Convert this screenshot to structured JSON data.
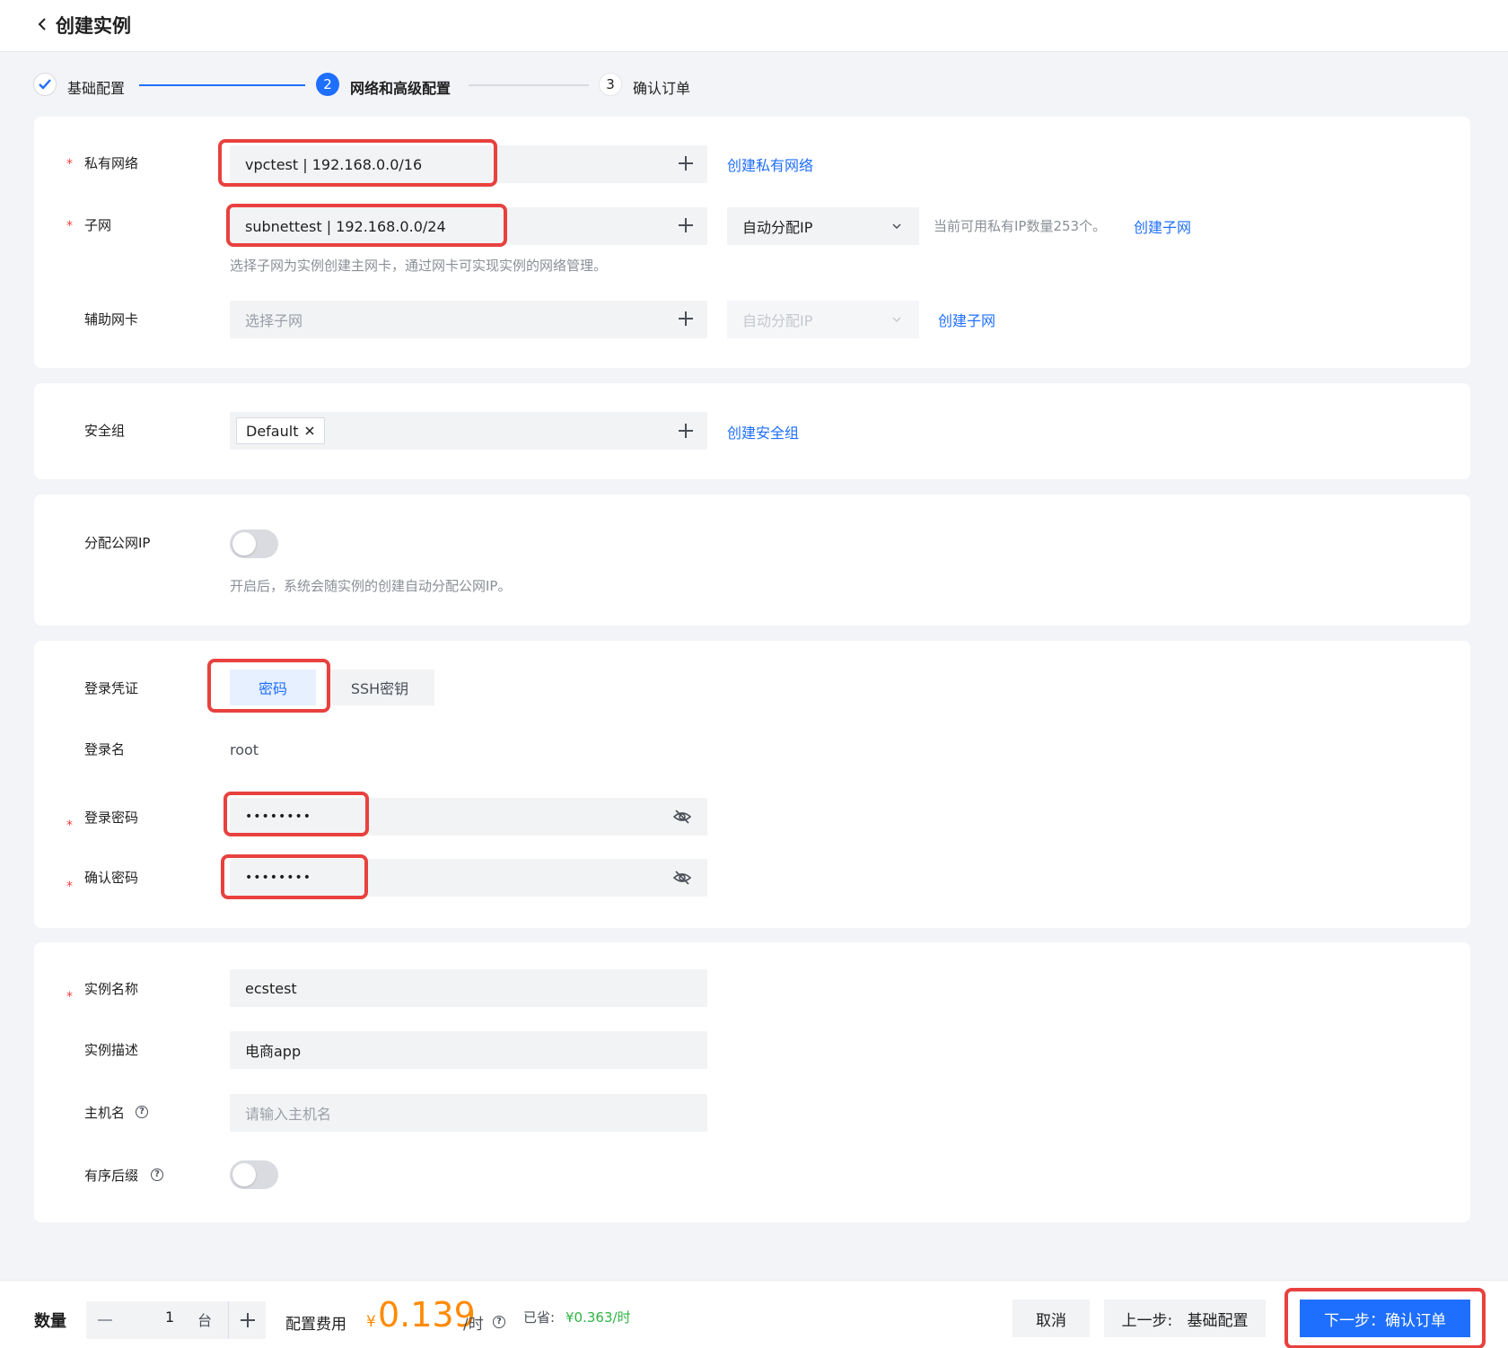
{
  "header": {
    "title": "创建实例"
  },
  "steps": [
    {
      "label": "基础配置",
      "state": "done"
    },
    {
      "number": "2",
      "label": "网络和高级配置",
      "state": "active"
    },
    {
      "number": "3",
      "label": "确认订单",
      "state": "pending"
    }
  ],
  "network": {
    "vpc": {
      "label": "私有网络",
      "value": "vpctest | 192.168.0.0/16",
      "link": "创建私有网络"
    },
    "subnet": {
      "label": "子网",
      "value": "subnettest | 192.168.0.0/24",
      "ip_mode": "自动分配IP",
      "available_hint": "当前可用私有IP数量253个。",
      "link": "创建子网",
      "hint": "选择子网为实例创建主网卡，通过网卡可实现实例的网络管理。"
    },
    "secondary_nic": {
      "label": "辅助网卡",
      "placeholder": "选择子网",
      "ip_mode": "自动分配IP",
      "link": "创建子网"
    }
  },
  "security": {
    "label": "安全组",
    "tag": "Default",
    "link": "创建安全组"
  },
  "public_ip": {
    "label": "分配公网IP",
    "hint": "开启后，系统会随实例的创建自动分配公网IP。",
    "enabled": false
  },
  "login": {
    "credential_label": "登录凭证",
    "credential_options": [
      "密码",
      "SSH密钥"
    ],
    "selected": "密码",
    "username_label": "登录名",
    "username": "root",
    "password_label": "登录密码",
    "password": "••••••••",
    "confirm_label": "确认密码",
    "confirm": "••••••••"
  },
  "instance": {
    "name_label": "实例名称",
    "name": "ecstest",
    "desc_label": "实例描述",
    "desc": "电商app",
    "host_label": "主机名",
    "host_placeholder": "请输入主机名",
    "suffix_label": "有序后缀",
    "suffix_enabled": false
  },
  "footer": {
    "qty_label": "数量",
    "qty": "1",
    "qty_unit": "台",
    "cost_label": "配置费用",
    "currency": "¥",
    "price": "0.139",
    "price_unit": "/时",
    "saved_label": "已省:",
    "saved": "¥0.363/时",
    "cancel": "取消",
    "prev": "上一步:   基础配置",
    "next": "下一步：确认订单"
  },
  "colors": {
    "primary": "#1f6fff",
    "accent_price": "#ff8a00",
    "saved": "#2fb344",
    "annotation": "#e8413e"
  }
}
